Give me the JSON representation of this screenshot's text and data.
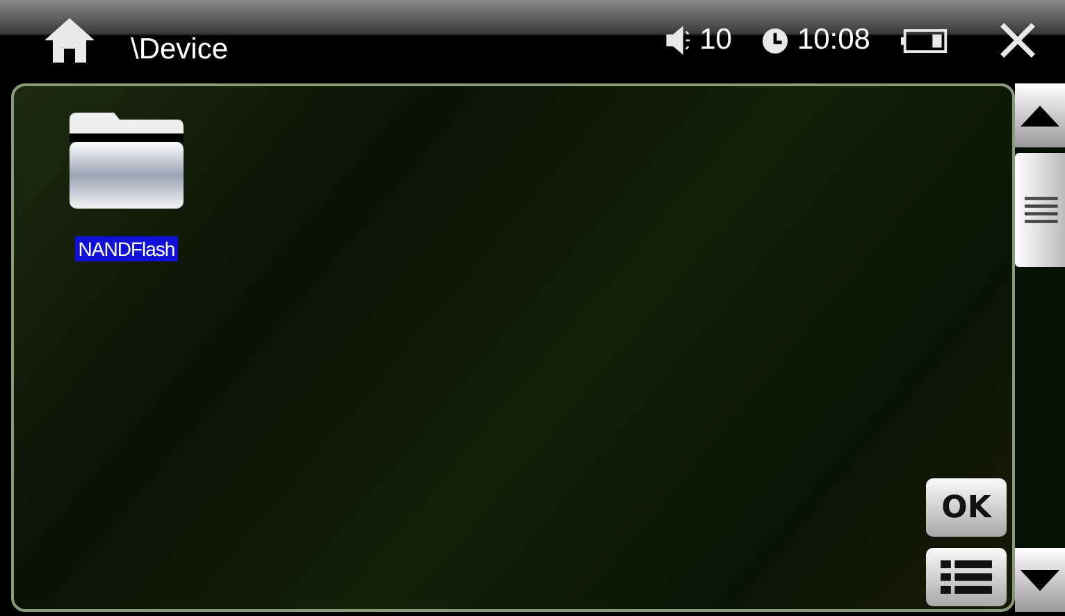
{
  "header": {
    "path": "\\Device",
    "volume": "10",
    "time": "10:08"
  },
  "files": [
    {
      "label": "NANDFlash",
      "selected": true
    }
  ],
  "ok_button": "OK"
}
